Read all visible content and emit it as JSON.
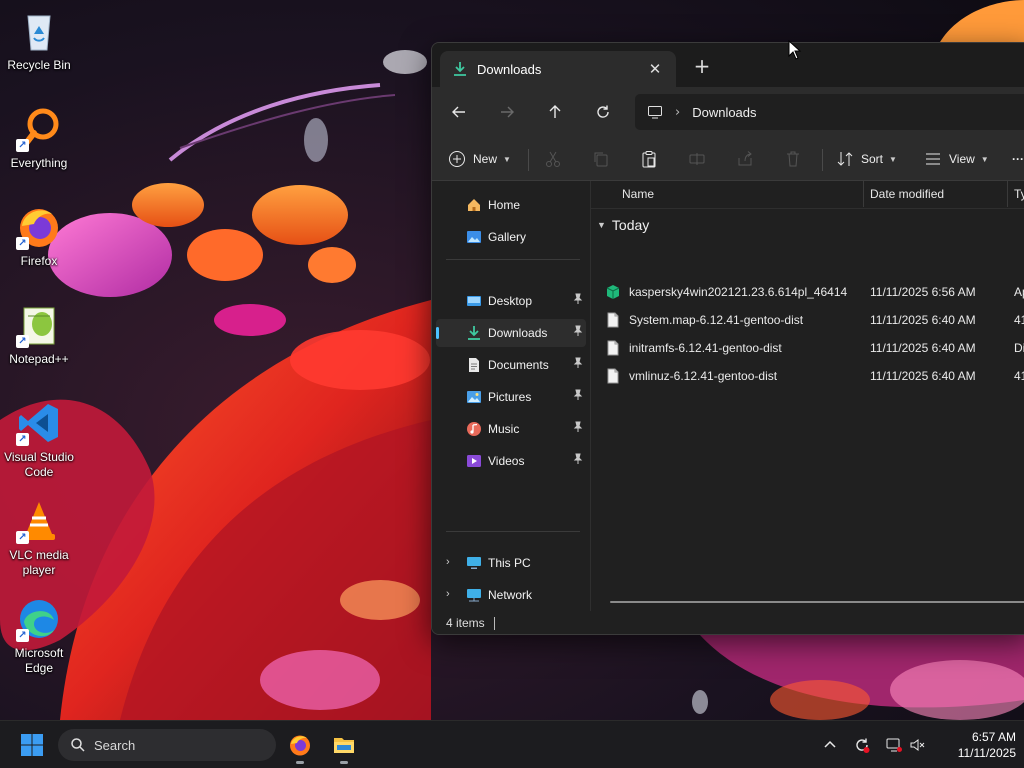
{
  "desktop": {
    "icons": [
      {
        "label": "Recycle Bin",
        "icon": "recycle-bin-icon"
      },
      {
        "label": "Everything",
        "icon": "everything-search-icon"
      },
      {
        "label": "Firefox",
        "icon": "firefox-icon"
      },
      {
        "label": "Notepad++",
        "icon": "notepad-plus-plus-icon"
      },
      {
        "label": "Visual Studio Code",
        "icon": "vscode-icon"
      },
      {
        "label": "VLC media player",
        "icon": "vlc-icon"
      },
      {
        "label": "Microsoft Edge",
        "icon": "edge-icon"
      }
    ]
  },
  "explorer": {
    "tab": {
      "title": "Downloads",
      "icon": "download-arrow-icon",
      "close": "✕"
    },
    "new_tab": "+",
    "address": {
      "crumbs": [
        "Downloads"
      ]
    },
    "toolbar": {
      "new_label": "New",
      "sort_label": "Sort",
      "view_label": "View",
      "more": "···"
    },
    "nav": {
      "home": "Home",
      "gallery": "Gallery",
      "desktop": "Desktop",
      "downloads": "Downloads",
      "documents": "Documents",
      "pictures": "Pictures",
      "music": "Music",
      "videos": "Videos",
      "this_pc": "This PC",
      "network": "Network",
      "selected": "Downloads"
    },
    "columns": {
      "name": "Name",
      "date": "Date modified",
      "type": "Ty"
    },
    "group": "Today",
    "files": [
      {
        "name": "kaspersky4win202121.23.6.614pl_46414",
        "date": "11/11/2025 6:56 AM",
        "type": "Ap",
        "icon": "installer-package-icon"
      },
      {
        "name": "System.map-6.12.41-gentoo-dist",
        "date": "11/11/2025 6:40 AM",
        "type": "41",
        "icon": "file-icon"
      },
      {
        "name": "initramfs-6.12.41-gentoo-dist",
        "date": "11/11/2025 6:40 AM",
        "type": "Di",
        "icon": "file-icon"
      },
      {
        "name": "vmlinuz-6.12.41-gentoo-dist",
        "date": "11/11/2025 6:40 AM",
        "type": "41",
        "icon": "file-icon"
      }
    ],
    "status": {
      "items": "4 items"
    }
  },
  "taskbar": {
    "search_placeholder": "Search",
    "clock": {
      "time": "6:57 AM",
      "date": "11/11/2025"
    },
    "colors": {
      "accent": "#4cc2ff",
      "start_blue": "#3b9cf2"
    }
  }
}
